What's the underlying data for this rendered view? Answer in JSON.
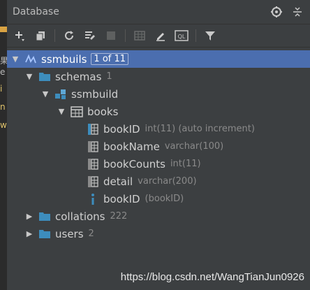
{
  "left_strip": {
    "lines": [
      "果",
      "e",
      "i",
      "n",
      "w"
    ]
  },
  "panel": {
    "title": "Database"
  },
  "icons": {
    "gear": "gear-icon",
    "collapse": "collapse-icon",
    "add": "add-icon",
    "duplicate": "duplicate-icon",
    "refresh": "refresh-icon",
    "properties": "properties-icon",
    "stop": "stop-icon",
    "table_view": "table-icon",
    "edit": "edit-icon",
    "console": "console-icon",
    "filter": "filter-icon"
  },
  "toolbar": {
    "console_label": "QL"
  },
  "tree": {
    "datasource": {
      "name": "ssmbuils",
      "badge": "1 of 11"
    },
    "schemas": {
      "name": "schemas",
      "count": "1"
    },
    "schema": {
      "name": "ssmbuild"
    },
    "table": {
      "name": "books"
    },
    "columns": [
      {
        "name": "bookID",
        "type": "int(11) (auto increment)"
      },
      {
        "name": "bookName",
        "type": "varchar(100)"
      },
      {
        "name": "bookCounts",
        "type": "int(11)"
      },
      {
        "name": "detail",
        "type": "varchar(200)"
      }
    ],
    "index": {
      "name": "bookID",
      "detail": "(bookID)"
    },
    "collations": {
      "name": "collations",
      "count": "222"
    },
    "users": {
      "name": "users",
      "count": "2"
    }
  },
  "watermark": "https://blog.csdn.net/WangTianJun0926",
  "colors": {
    "background": "#3c3f41",
    "selection": "#4b6eaf",
    "folder": "#3d8dbd",
    "accent_yellow": "#d9a343"
  }
}
